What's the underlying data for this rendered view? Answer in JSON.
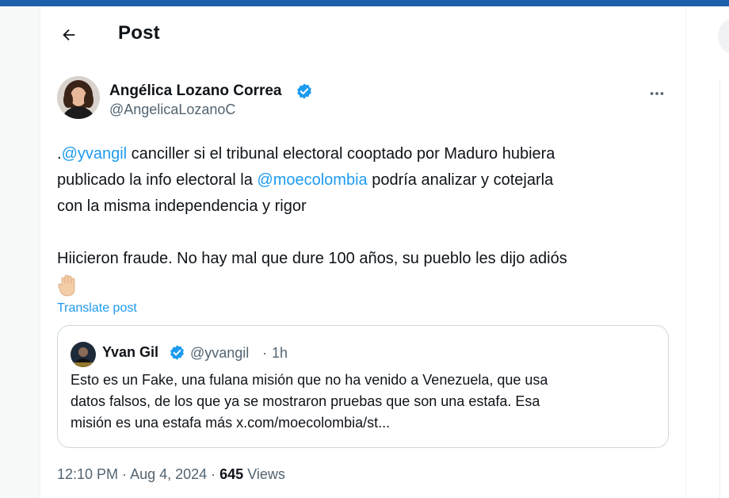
{
  "header": {
    "title": "Post"
  },
  "author": {
    "name": "Angélica Lozano Correa",
    "handle": "@AngelicaLozanoC"
  },
  "post": {
    "line1": {
      "prefix": ".",
      "mention": "@yvangil",
      "rest": " canciller si el tribunal electoral cooptado por Maduro hubiera"
    },
    "line2": {
      "before": "publicado la info electoral la ",
      "mention": "@moecolombia",
      "after": " podría analizar y cotejarla"
    },
    "line3": "con la misma independencia y rigor",
    "line4": "Hiicieron fraude. No hay mal que dure 100 años, su pueblo les dijo adiós",
    "emoji": "raised-hand"
  },
  "translate_label": "Translate post",
  "quote": {
    "name": "Yvan Gil",
    "handle": "@yvangil",
    "separator": "·",
    "time": "1h",
    "lines": [
      "Esto es un Fake, una fulana misión que no ha venido a Venezuela, que usa",
      "datos falsos, de los que ya se mostraron pruebas que son una estafa. Esa",
      "misión es una estafa más x.com/moecolombia/st..."
    ]
  },
  "meta": {
    "time": "12:10 PM",
    "separator1": " · ",
    "date": "Aug 4, 2024",
    "separator2": " · ",
    "views_count": "645",
    "views_label": " Views"
  },
  "colors": {
    "accent": "#1d9bf0",
    "text_primary": "#0f1419",
    "text_secondary": "#536471",
    "border": "#cfd9de",
    "top_bar": "#1d5fa8"
  }
}
